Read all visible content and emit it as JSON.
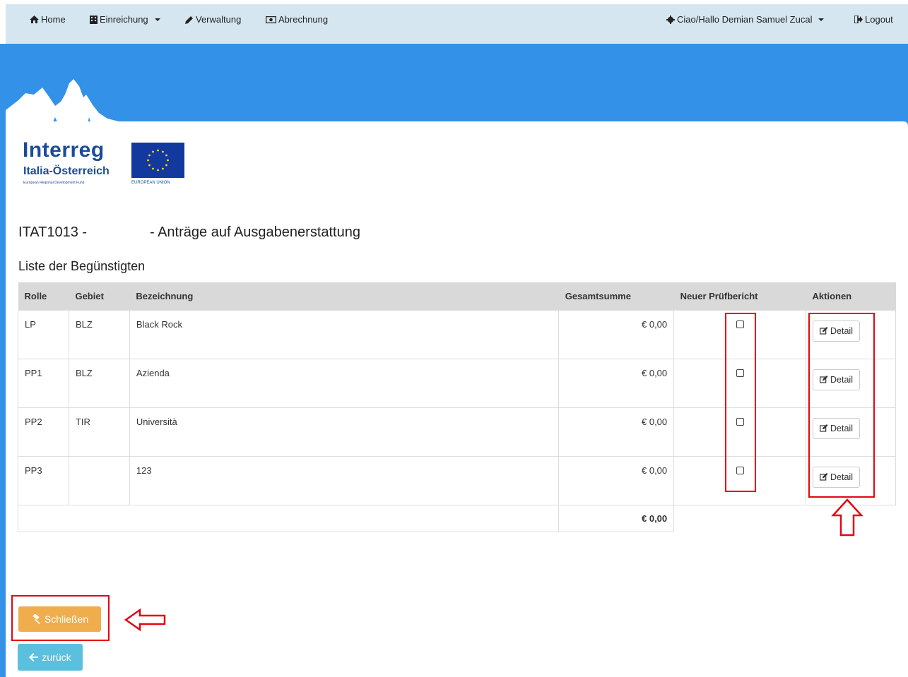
{
  "nav": {
    "home": "Home",
    "einreichung": "Einreichung",
    "verwaltung": "Verwaltung",
    "abrechnung": "Abrechnung",
    "user": "Ciao/Hallo Demian Samuel Zucal",
    "logout": "Logout"
  },
  "logo": {
    "brand": "Interreg",
    "region": "Italia-Österreich",
    "fund": "European Regional Development Fund",
    "eu": "EUROPEAN UNION"
  },
  "page": {
    "title": "ITAT1013 -                - Anträge auf Ausgabenerstattung",
    "section": "Liste der Begünstigten"
  },
  "table": {
    "headers": [
      "Rolle",
      "Gebiet",
      "Bezeichnung",
      "Gesamtsumme",
      "Neuer Prüfbericht",
      "Aktionen"
    ],
    "rows": [
      {
        "rolle": "LP",
        "gebiet": "BLZ",
        "bezeichnung": "Black Rock",
        "summe": "€ 0,00",
        "action": "Detail"
      },
      {
        "rolle": "PP1",
        "gebiet": "BLZ",
        "bezeichnung": "Azienda",
        "summe": "€ 0,00",
        "action": "Detail"
      },
      {
        "rolle": "PP2",
        "gebiet": "TIR",
        "bezeichnung": "Università",
        "summe": "€ 0,00",
        "action": "Detail"
      },
      {
        "rolle": "PP3",
        "gebiet": "",
        "bezeichnung": "123",
        "summe": "€ 0,00",
        "action": "Detail"
      }
    ],
    "total": "€ 0,00"
  },
  "buttons": {
    "close": "Schließen",
    "back": "zurück"
  },
  "colors": {
    "banner": "#3391e8",
    "navbar": "#d6e6f1",
    "warning": "#f0ad4e",
    "info": "#5bc0de",
    "annotation": "#e30613"
  }
}
